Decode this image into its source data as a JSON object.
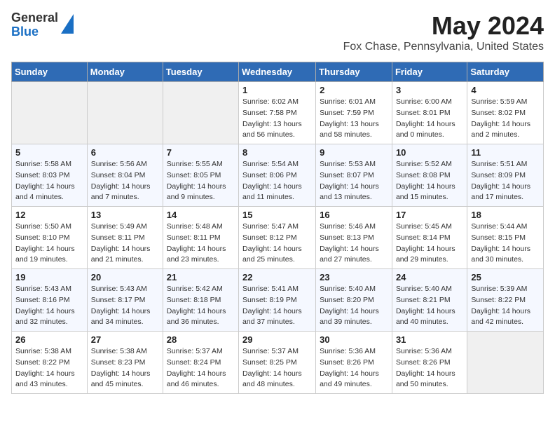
{
  "logo": {
    "general": "General",
    "blue": "Blue"
  },
  "title": "May 2024",
  "subtitle": "Fox Chase, Pennsylvania, United States",
  "days_of_week": [
    "Sunday",
    "Monday",
    "Tuesday",
    "Wednesday",
    "Thursday",
    "Friday",
    "Saturday"
  ],
  "weeks": [
    [
      {
        "day": "",
        "info": ""
      },
      {
        "day": "",
        "info": ""
      },
      {
        "day": "",
        "info": ""
      },
      {
        "day": "1",
        "info": "Sunrise: 6:02 AM\nSunset: 7:58 PM\nDaylight: 13 hours and 56 minutes."
      },
      {
        "day": "2",
        "info": "Sunrise: 6:01 AM\nSunset: 7:59 PM\nDaylight: 13 hours and 58 minutes."
      },
      {
        "day": "3",
        "info": "Sunrise: 6:00 AM\nSunset: 8:01 PM\nDaylight: 14 hours and 0 minutes."
      },
      {
        "day": "4",
        "info": "Sunrise: 5:59 AM\nSunset: 8:02 PM\nDaylight: 14 hours and 2 minutes."
      }
    ],
    [
      {
        "day": "5",
        "info": "Sunrise: 5:58 AM\nSunset: 8:03 PM\nDaylight: 14 hours and 4 minutes."
      },
      {
        "day": "6",
        "info": "Sunrise: 5:56 AM\nSunset: 8:04 PM\nDaylight: 14 hours and 7 minutes."
      },
      {
        "day": "7",
        "info": "Sunrise: 5:55 AM\nSunset: 8:05 PM\nDaylight: 14 hours and 9 minutes."
      },
      {
        "day": "8",
        "info": "Sunrise: 5:54 AM\nSunset: 8:06 PM\nDaylight: 14 hours and 11 minutes."
      },
      {
        "day": "9",
        "info": "Sunrise: 5:53 AM\nSunset: 8:07 PM\nDaylight: 14 hours and 13 minutes."
      },
      {
        "day": "10",
        "info": "Sunrise: 5:52 AM\nSunset: 8:08 PM\nDaylight: 14 hours and 15 minutes."
      },
      {
        "day": "11",
        "info": "Sunrise: 5:51 AM\nSunset: 8:09 PM\nDaylight: 14 hours and 17 minutes."
      }
    ],
    [
      {
        "day": "12",
        "info": "Sunrise: 5:50 AM\nSunset: 8:10 PM\nDaylight: 14 hours and 19 minutes."
      },
      {
        "day": "13",
        "info": "Sunrise: 5:49 AM\nSunset: 8:11 PM\nDaylight: 14 hours and 21 minutes."
      },
      {
        "day": "14",
        "info": "Sunrise: 5:48 AM\nSunset: 8:11 PM\nDaylight: 14 hours and 23 minutes."
      },
      {
        "day": "15",
        "info": "Sunrise: 5:47 AM\nSunset: 8:12 PM\nDaylight: 14 hours and 25 minutes."
      },
      {
        "day": "16",
        "info": "Sunrise: 5:46 AM\nSunset: 8:13 PM\nDaylight: 14 hours and 27 minutes."
      },
      {
        "day": "17",
        "info": "Sunrise: 5:45 AM\nSunset: 8:14 PM\nDaylight: 14 hours and 29 minutes."
      },
      {
        "day": "18",
        "info": "Sunrise: 5:44 AM\nSunset: 8:15 PM\nDaylight: 14 hours and 30 minutes."
      }
    ],
    [
      {
        "day": "19",
        "info": "Sunrise: 5:43 AM\nSunset: 8:16 PM\nDaylight: 14 hours and 32 minutes."
      },
      {
        "day": "20",
        "info": "Sunrise: 5:43 AM\nSunset: 8:17 PM\nDaylight: 14 hours and 34 minutes."
      },
      {
        "day": "21",
        "info": "Sunrise: 5:42 AM\nSunset: 8:18 PM\nDaylight: 14 hours and 36 minutes."
      },
      {
        "day": "22",
        "info": "Sunrise: 5:41 AM\nSunset: 8:19 PM\nDaylight: 14 hours and 37 minutes."
      },
      {
        "day": "23",
        "info": "Sunrise: 5:40 AM\nSunset: 8:20 PM\nDaylight: 14 hours and 39 minutes."
      },
      {
        "day": "24",
        "info": "Sunrise: 5:40 AM\nSunset: 8:21 PM\nDaylight: 14 hours and 40 minutes."
      },
      {
        "day": "25",
        "info": "Sunrise: 5:39 AM\nSunset: 8:22 PM\nDaylight: 14 hours and 42 minutes."
      }
    ],
    [
      {
        "day": "26",
        "info": "Sunrise: 5:38 AM\nSunset: 8:22 PM\nDaylight: 14 hours and 43 minutes."
      },
      {
        "day": "27",
        "info": "Sunrise: 5:38 AM\nSunset: 8:23 PM\nDaylight: 14 hours and 45 minutes."
      },
      {
        "day": "28",
        "info": "Sunrise: 5:37 AM\nSunset: 8:24 PM\nDaylight: 14 hours and 46 minutes."
      },
      {
        "day": "29",
        "info": "Sunrise: 5:37 AM\nSunset: 8:25 PM\nDaylight: 14 hours and 48 minutes."
      },
      {
        "day": "30",
        "info": "Sunrise: 5:36 AM\nSunset: 8:26 PM\nDaylight: 14 hours and 49 minutes."
      },
      {
        "day": "31",
        "info": "Sunrise: 5:36 AM\nSunset: 8:26 PM\nDaylight: 14 hours and 50 minutes."
      },
      {
        "day": "",
        "info": ""
      }
    ]
  ]
}
